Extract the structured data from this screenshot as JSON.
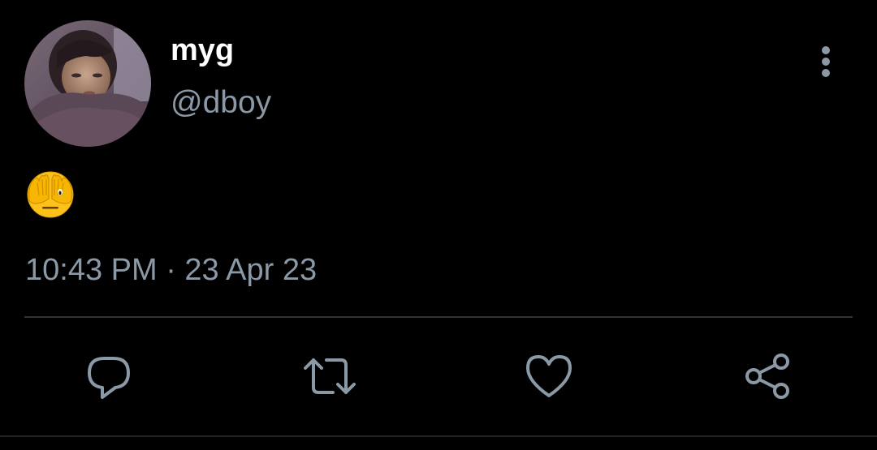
{
  "user": {
    "display_name": "myg",
    "handle": "@dboy"
  },
  "tweet": {
    "body_emoji": "face-with-hands-over-eyes-emoji",
    "timestamp": "10:43 PM · 23 Apr 23"
  },
  "actions": {
    "reply_icon": "speech-bubble-icon",
    "retweet_icon": "retweet-icon",
    "like_icon": "heart-icon",
    "share_icon": "share-icon",
    "more_icon": "vertical-ellipsis-icon"
  },
  "colors": {
    "background": "#000000",
    "display_name": "#ffffff",
    "secondary_text": "#8b98a5",
    "divider": "#2f3336"
  }
}
